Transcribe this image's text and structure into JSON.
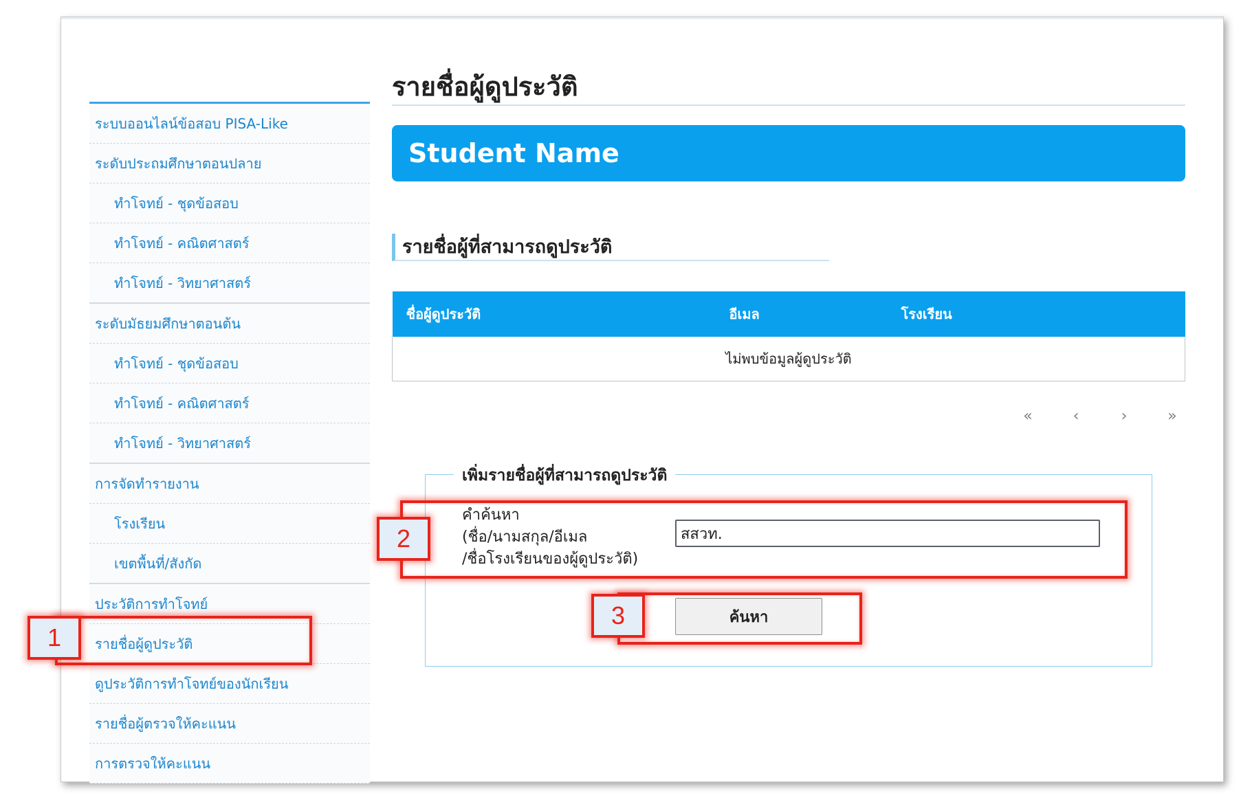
{
  "sidebar": {
    "items": [
      {
        "label": "ระบบออนไลน์ข้อสอบ PISA-Like",
        "level": 0
      },
      {
        "label": "ระดับประถมศึกษาตอนปลาย",
        "level": 0
      },
      {
        "label": "ทำโจทย์ - ชุดข้อสอบ",
        "level": 1
      },
      {
        "label": "ทำโจทย์ - คณิตศาสตร์",
        "level": 1
      },
      {
        "label": "ทำโจทย์ - วิทยาศาสตร์",
        "level": 1
      },
      {
        "label": "ระดับมัธยมศึกษาตอนต้น",
        "level": 0
      },
      {
        "label": "ทำโจทย์ - ชุดข้อสอบ",
        "level": 1
      },
      {
        "label": "ทำโจทย์ - คณิตศาสตร์",
        "level": 1
      },
      {
        "label": "ทำโจทย์ - วิทยาศาสตร์",
        "level": 1
      },
      {
        "label": "การจัดทำรายงาน",
        "level": 0
      },
      {
        "label": "โรงเรียน",
        "level": 1
      },
      {
        "label": "เขตพื้นที่/สังกัด",
        "level": 1
      },
      {
        "label": "ประวัติการทำโจทย์",
        "level": 0
      },
      {
        "label": "รายชื่อผู้ดูประวัติ",
        "level": 0
      },
      {
        "label": "ดูประวัติการทำโจทย์ของนักเรียน",
        "level": 0
      },
      {
        "label": "รายชื่อผู้ตรวจให้คะแนน",
        "level": 0
      },
      {
        "label": "การตรวจให้คะแนน",
        "level": 0
      }
    ]
  },
  "main": {
    "page_title": "รายชื่อผู้ดูประวัติ",
    "banner_title": "Student Name",
    "section_heading": "รายชื่อผู้ที่สามารถดูประวัติ",
    "table": {
      "columns": [
        "ชื่อผู้ดูประวัติ",
        "อีเมล",
        "โรงเรียน"
      ],
      "empty_message": "ไม่พบข้อมูลผู้ดูประวัติ"
    },
    "pager": {
      "first": "«",
      "prev": "‹",
      "next": "›",
      "last": "»"
    }
  },
  "add_form": {
    "legend": "เพิ่มรายชื่อผู้ที่สามารถดูประวัติ",
    "search_label_lines": [
      "คำค้นหา",
      "(ชื่อ/นามสกุล/อีเมล",
      "/ชื่อโรงเรียนของผู้ดูประวัติ)"
    ],
    "search_value": "สสวท.",
    "search_button": "ค้นหา"
  },
  "callouts": [
    "1",
    "2",
    "3"
  ]
}
